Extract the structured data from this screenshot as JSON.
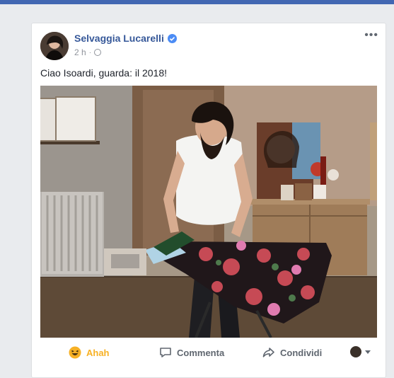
{
  "post": {
    "author": "Selvaggia Lucarelli",
    "time": "2 h",
    "text": "Ciao Isoardi, guarda: il 2018!",
    "more_label": "•••"
  },
  "actions": {
    "like_label": "Ahah",
    "comment_label": "Commenta",
    "share_label": "Condividi"
  },
  "colors": {
    "brand_blue": "#4267b2",
    "link_blue": "#365899",
    "reaction_yellow": "#f7b125"
  },
  "icons": {
    "verified": "verified-badge-icon",
    "privacy": "globe-icon",
    "reaction": "haha-emoji-icon",
    "comment": "comment-bubble-icon",
    "share": "share-arrow-icon"
  }
}
